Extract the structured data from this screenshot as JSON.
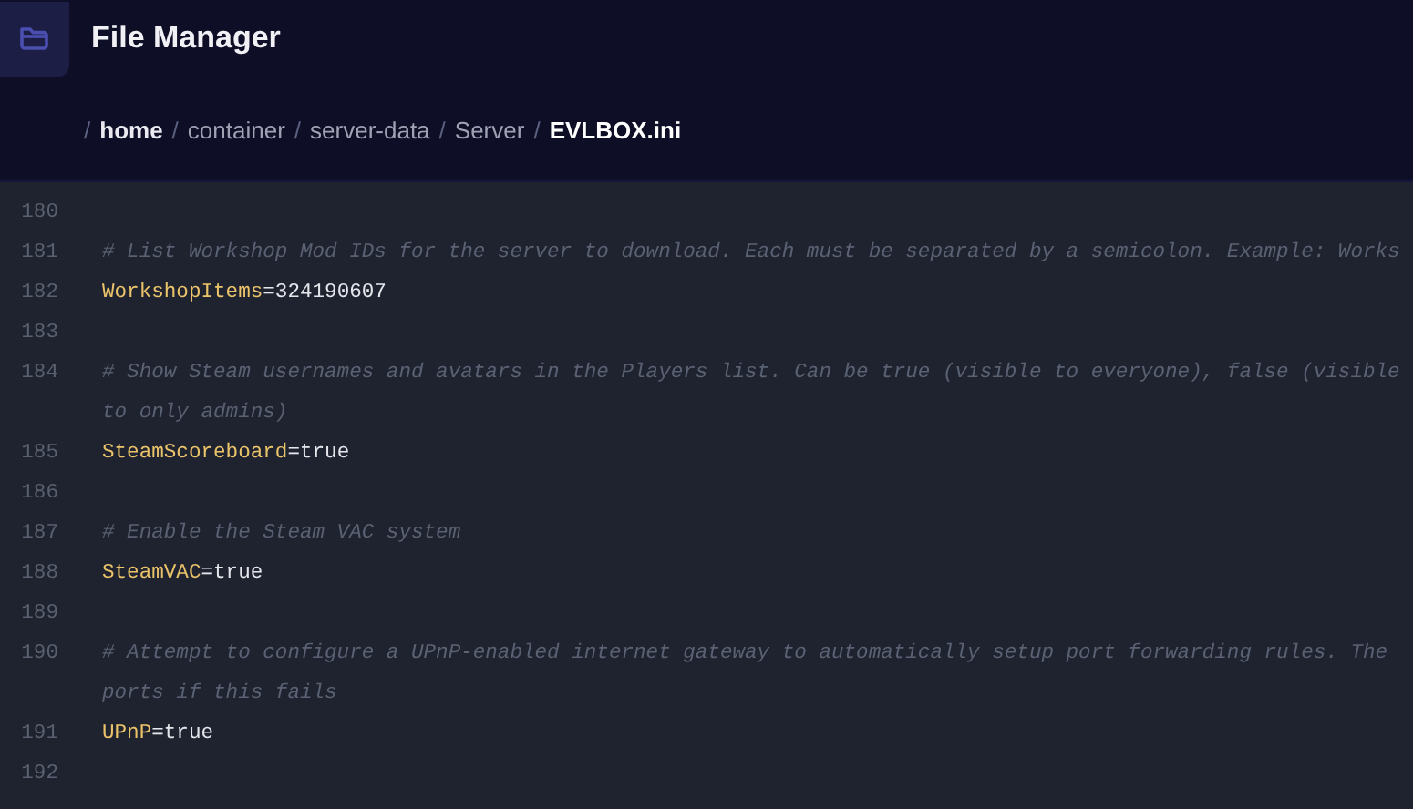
{
  "header": {
    "title": "File Manager"
  },
  "breadcrumb": [
    {
      "separator": "/",
      "label": "home",
      "current": false,
      "bold": true
    },
    {
      "separator": "/",
      "label": "container",
      "current": false,
      "bold": false
    },
    {
      "separator": "/",
      "label": "server-data",
      "current": false,
      "bold": false
    },
    {
      "separator": "/",
      "label": "Server",
      "current": false,
      "bold": false
    },
    {
      "separator": "/",
      "label": "EVLBOX.ini",
      "current": true,
      "bold": true
    }
  ],
  "editor": {
    "lines": [
      {
        "number": "180",
        "kind": "blank"
      },
      {
        "number": "181",
        "kind": "comment",
        "text": [
          "# List Workshop Mod IDs for the server to download. Each must be separated by a semicolon. Example: Works"
        ]
      },
      {
        "number": "182",
        "kind": "setting",
        "key": "WorkshopItems",
        "value": "=324190607"
      },
      {
        "number": "183",
        "kind": "blank"
      },
      {
        "number": "184",
        "kind": "comment",
        "text": [
          "# Show Steam usernames and avatars in the Players list. Can be true (visible to everyone), false (visible",
          "to only admins)"
        ]
      },
      {
        "number": "185",
        "kind": "setting",
        "key": "SteamScoreboard",
        "value": "=true"
      },
      {
        "number": "186",
        "kind": "blank"
      },
      {
        "number": "187",
        "kind": "comment",
        "text": [
          "# Enable the Steam VAC system"
        ]
      },
      {
        "number": "188",
        "kind": "setting",
        "key": "SteamVAC",
        "value": "=true"
      },
      {
        "number": "189",
        "kind": "blank"
      },
      {
        "number": "190",
        "kind": "comment",
        "text": [
          "# Attempt to configure a UPnP-enabled internet gateway to automatically setup port forwarding rules. The",
          "ports if this fails"
        ]
      },
      {
        "number": "191",
        "kind": "setting",
        "key": "UPnP",
        "value": "=true"
      },
      {
        "number": "192",
        "kind": "blank"
      }
    ]
  }
}
